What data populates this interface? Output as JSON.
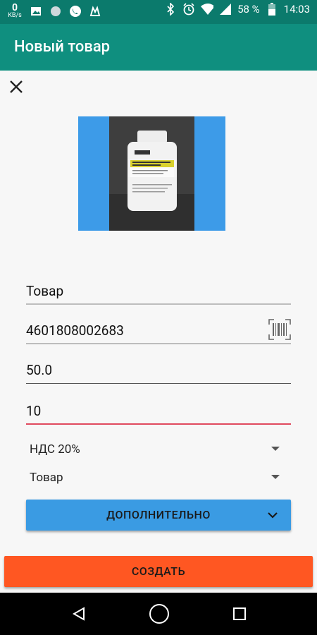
{
  "statusbar": {
    "kbs_value": "0",
    "kbs_unit": "KB/s",
    "battery": "58 %",
    "time": "14:03"
  },
  "appbar": {
    "title": "Новый товар"
  },
  "form": {
    "name": "Товар",
    "barcode": "4601808002683",
    "price": "50.0",
    "quantity": "10",
    "vat": "НДС 20%",
    "type": "Товар"
  },
  "buttons": {
    "more": "ДОПОЛНИТЕЛЬНО",
    "create": "СОЗДАТЬ"
  },
  "colors": {
    "statusbar": "#0b7a6c",
    "appbar": "#0f8f7f",
    "more_button": "#3a9be3",
    "create_button": "#ff5722",
    "active_underline": "#e04a5f"
  }
}
